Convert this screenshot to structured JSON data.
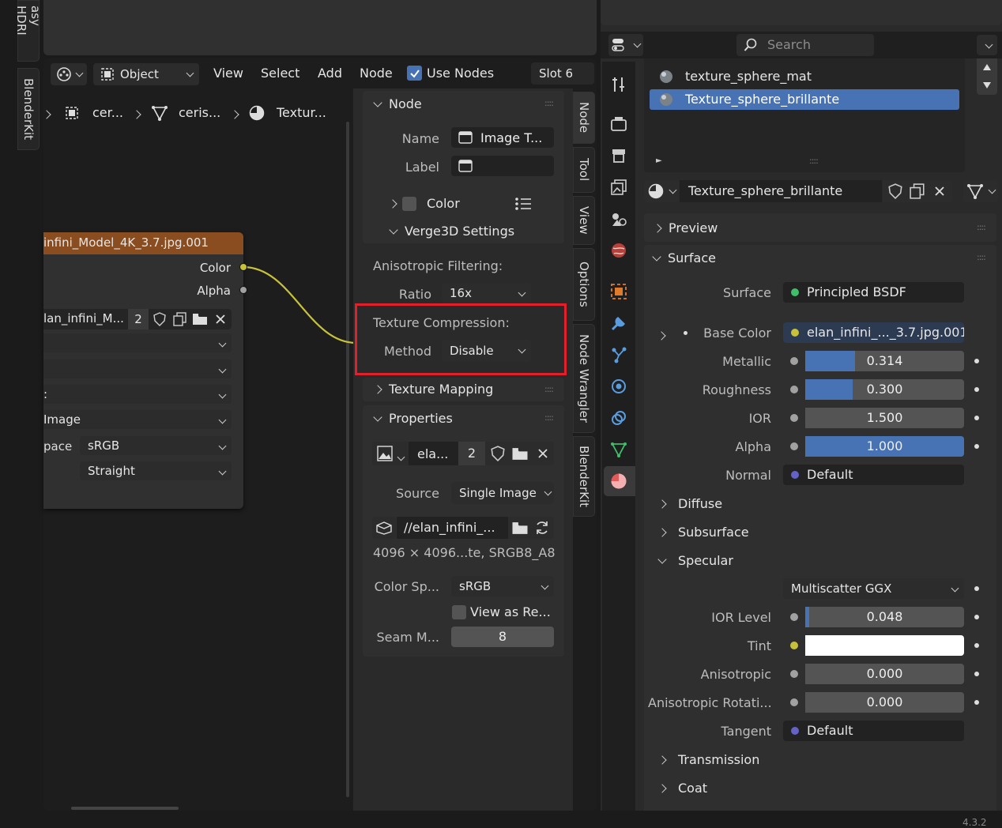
{
  "left_tabs": [
    "asy HDRI",
    "BlenderKit"
  ],
  "node_editor": {
    "header": {
      "mode": "Object",
      "menu": [
        "View",
        "Select",
        "Add",
        "Node"
      ],
      "use_nodes": "Use Nodes",
      "slot": "Slot 6"
    },
    "breadcrumb": [
      "cer...",
      "ceris...",
      "Textur..."
    ],
    "node": {
      "title": "infini_Model_4K_3.7.jpg.001",
      "outputs": [
        "Color",
        "Alpha"
      ],
      "image_name": "lan_infini_M...",
      "users": "2",
      "rows": [
        "",
        "",
        ":",
        "Image",
        "sRGB",
        "Straight"
      ],
      "color_space_label": "pace"
    }
  },
  "sidebar": {
    "node_panel": {
      "title": "Node",
      "name_label": "Name",
      "name_value": "Image T...",
      "label_label": "Label",
      "label_value": "",
      "color_label": "Color",
      "verge_title": "Verge3D Settings",
      "aniso_title": "Anisotropic Filtering:",
      "ratio_label": "Ratio",
      "ratio_value": "16x",
      "compress_title": "Texture Compression:",
      "method_label": "Method",
      "method_value": "Disable",
      "mapping_title": "Texture Mapping"
    },
    "properties_panel": {
      "title": "Properties",
      "image_name": "ela...",
      "users": "2",
      "source_label": "Source",
      "source_value": "Single Image",
      "path": "//elan_infini_...",
      "info": "4096 × 4096...te, SRGB8_A8",
      "colorspace_label": "Color Sp...",
      "colorspace_value": "sRGB",
      "view_as": "View as Re...",
      "seam_label": "Seam M...",
      "seam_value": "8"
    },
    "tabs": [
      "Node",
      "Tool",
      "View",
      "Options",
      "Node Wrangler",
      "BlenderKit"
    ]
  },
  "properties": {
    "search_placeholder": "Search",
    "materials": [
      "texture_sphere_mat",
      "Texture_sphere_brillante"
    ],
    "active_material": "Texture_sphere_brillante",
    "preview": "Preview",
    "surface_section": "Surface",
    "surface_label": "Surface",
    "surface_value": "Principled BSDF",
    "base_color_label": "Base Color",
    "base_color_value": "elan_infini_..._3.7.jpg.001",
    "sliders": [
      {
        "label": "Metallic",
        "value": "0.314",
        "fill": 0.314
      },
      {
        "label": "Roughness",
        "value": "0.300",
        "fill": 0.3
      },
      {
        "label": "IOR",
        "value": "1.500",
        "fill": 0
      },
      {
        "label": "Alpha",
        "value": "1.000",
        "fill": 1
      }
    ],
    "normal_label": "Normal",
    "normal_value": "Default",
    "subsections": [
      "Diffuse",
      "Subsurface",
      "Specular"
    ],
    "distribution": "Multiscatter GGX",
    "spec_sliders": [
      {
        "label": "IOR Level",
        "value": "0.048",
        "fill": 0.024
      },
      {
        "label": "Anisotropic",
        "value": "0.000",
        "fill": 0
      },
      {
        "label": "Anisotropic Rotati...",
        "value": "0.000",
        "fill": 0
      }
    ],
    "tint_label": "Tint",
    "tangent_label": "Tangent",
    "tangent_value": "Default",
    "more_sections": [
      "Transmission",
      "Coat"
    ],
    "version": "4.3.2"
  }
}
